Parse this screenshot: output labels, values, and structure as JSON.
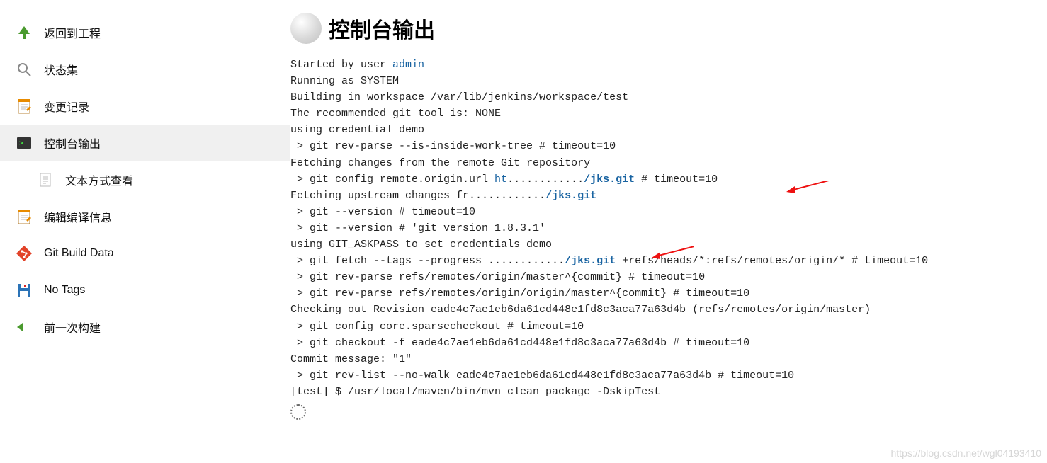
{
  "sidebar": {
    "back": {
      "label": "返回到工程"
    },
    "status": {
      "label": "状态集"
    },
    "changes": {
      "label": "变更记录"
    },
    "console": {
      "label": "控制台输出"
    },
    "plain": {
      "label": "文本方式查看"
    },
    "editinfo": {
      "label": "编辑编译信息"
    },
    "gitbuild": {
      "label": "Git Build Data"
    },
    "notags": {
      "label": "No Tags"
    },
    "prevbuild": {
      "label": "前一次构建"
    }
  },
  "page": {
    "title": "控制台输出",
    "watermark": "https://blog.csdn.net/wgl04193410"
  },
  "console": {
    "lines": [
      {
        "t": "Started by user ",
        "link": "admin"
      },
      {
        "t": "Running as SYSTEM"
      },
      {
        "t": "Building in workspace /var/lib/jenkins/workspace/test"
      },
      {
        "t": "The recommended git tool is: NONE"
      },
      {
        "t": "using credential demo"
      },
      {
        "t": " > git rev-parse --is-inside-work-tree # timeout=10"
      },
      {
        "t": "Fetching changes from the remote Git repository"
      },
      {
        "t": " > git config remote.origin.url ",
        "link": "ht",
        "t2": "............",
        "bold": "/jks.git",
        "tail": " # timeout=10"
      },
      {
        "t": "Fetching upstream changes fr............",
        "bold": "/jks.git"
      },
      {
        "t": " > git --version # timeout=10"
      },
      {
        "t": " > git --version # 'git version 1.8.3.1'"
      },
      {
        "t": "using GIT_ASKPASS to set credentials demo"
      },
      {
        "t": " > git fetch --tags --progress ............",
        "bold": "/jks.git",
        "tail": " +refs/heads/*:refs/remotes/origin/* # timeout=10"
      },
      {
        "t": " > git rev-parse refs/remotes/origin/master^{commit} # timeout=10"
      },
      {
        "t": " > git rev-parse refs/remotes/origin/origin/master^{commit} # timeout=10"
      },
      {
        "t": "Checking out Revision eade4c7ae1eb6da61cd448e1fd8c3aca77a63d4b (refs/remotes/origin/master)"
      },
      {
        "t": " > git config core.sparsecheckout # timeout=10"
      },
      {
        "t": " > git checkout -f eade4c7ae1eb6da61cd448e1fd8c3aca77a63d4b # timeout=10"
      },
      {
        "t": "Commit message: \"1\""
      },
      {
        "t": " > git rev-list --no-walk eade4c7ae1eb6da61cd448e1fd8c3aca77a63d4b # timeout=10"
      },
      {
        "t": "[test] $ /usr/local/maven/bin/mvn clean package -DskipTest"
      }
    ]
  }
}
